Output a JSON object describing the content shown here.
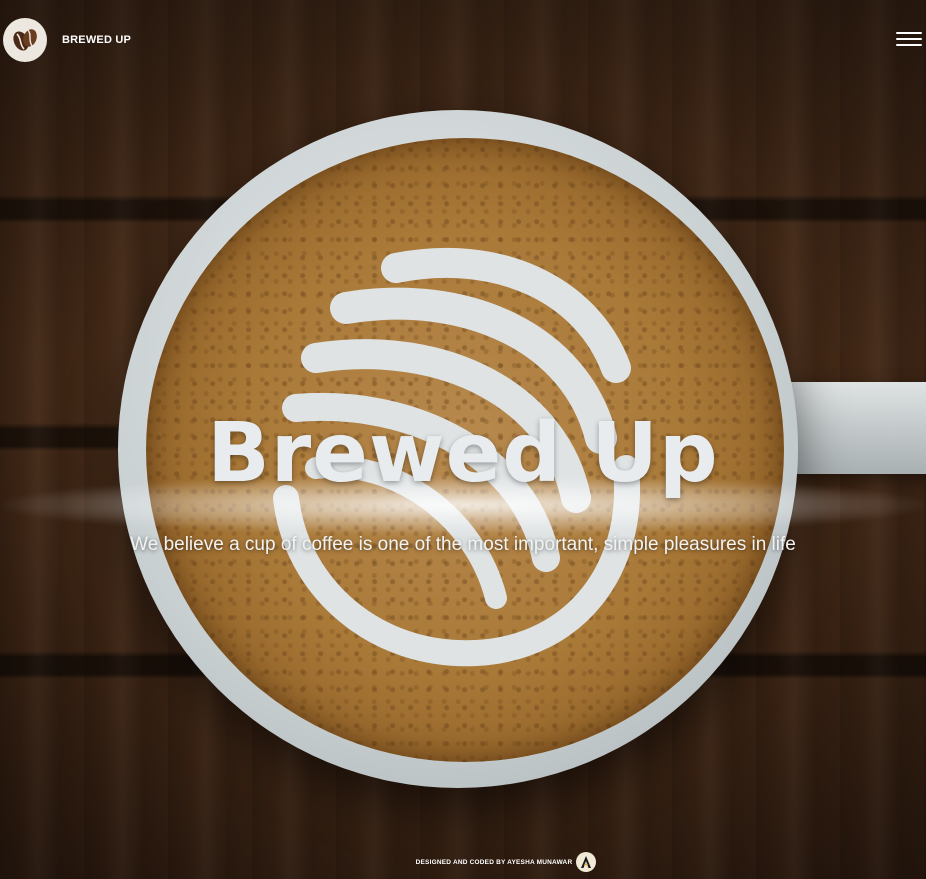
{
  "header": {
    "brand": "BREWED UP",
    "logo_icon": "coffee-beans-icon",
    "menu_icon": "hamburger-menu-icon"
  },
  "hero": {
    "title": "Brewed Up",
    "subtitle": "We believe a cup of coffee is one of the most important, simple pleasures in life"
  },
  "footer": {
    "credit": "DESIGNED AND CODED BY AYESHA MUNAWAR",
    "credit_logo_icon": "author-logo-icon"
  },
  "colors": {
    "text": "#ffffff",
    "title": "#e9ecee",
    "logo_bg": "#ece7df",
    "coffee": "#a97938",
    "wood": "#4a2d19"
  }
}
